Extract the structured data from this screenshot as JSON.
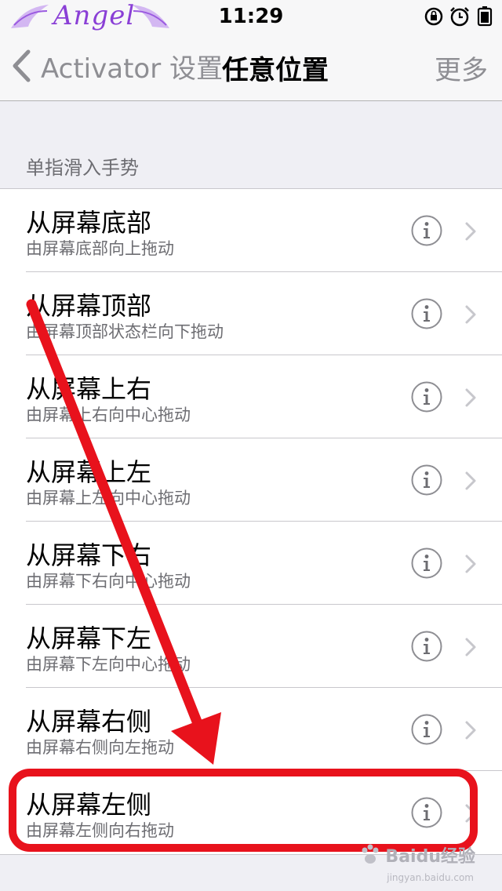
{
  "status_bar": {
    "carrier_logo": "Angel",
    "time": "11:29",
    "icons": [
      "orientation-lock-icon",
      "alarm-icon",
      "battery-icon"
    ]
  },
  "nav": {
    "back_label": "Activator 设置",
    "title": "任意位置",
    "more_label": "更多"
  },
  "section": {
    "header": "单指滑入手势",
    "rows": [
      {
        "title": "从屏幕底部",
        "subtitle": "由屏幕底部向上拖动"
      },
      {
        "title": "从屏幕顶部",
        "subtitle": "由屏幕顶部状态栏向下拖动"
      },
      {
        "title": "从屏幕上右",
        "subtitle": "由屏幕上右向中心拖动"
      },
      {
        "title": "从屏幕上左",
        "subtitle": "由屏幕上左向中心拖动"
      },
      {
        "title": "从屏幕下右",
        "subtitle": "由屏幕下右向中心拖动"
      },
      {
        "title": "从屏幕下左",
        "subtitle": "由屏幕下左向中心拖动"
      },
      {
        "title": "从屏幕右侧",
        "subtitle": "由屏幕右侧向左拖动"
      },
      {
        "title": "从屏幕左侧",
        "subtitle": "由屏幕左侧向右拖动"
      }
    ]
  },
  "watermark": {
    "text": "Baidu经验",
    "sub": "jingyan.baidu.com"
  },
  "colors": {
    "annotation_red": "#e8121c",
    "info_gray": "#8e8e93",
    "logo_purple": "#8a3fd6"
  }
}
